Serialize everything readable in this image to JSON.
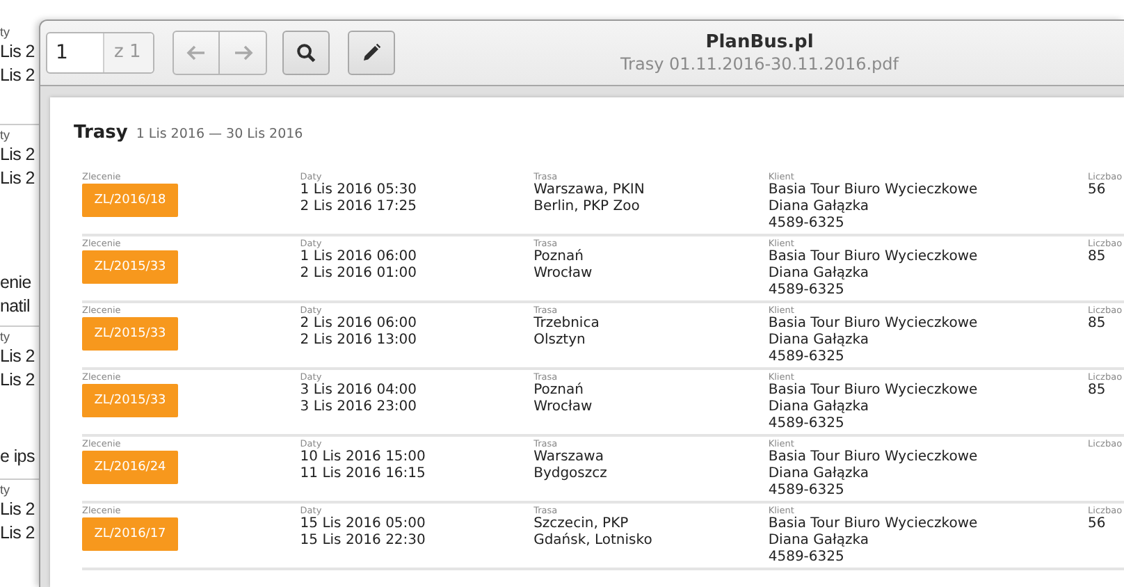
{
  "background_page": {
    "blocks": [
      {
        "lines": [
          {
            "kind": "label",
            "text": "ty"
          },
          {
            "kind": "value",
            "text": "Lis 2"
          },
          {
            "kind": "value",
            "text": "Lis 2"
          }
        ]
      },
      {
        "lines": [
          {
            "kind": "label",
            "text": "ty"
          },
          {
            "kind": "value",
            "text": "Lis 2"
          },
          {
            "kind": "value",
            "text": "Lis 2"
          }
        ]
      },
      {
        "lines": [
          {
            "kind": "value",
            "text": "enie"
          },
          {
            "kind": "value",
            "text": "natil"
          }
        ]
      },
      {
        "lines": [
          {
            "kind": "label",
            "text": "ty"
          },
          {
            "kind": "value",
            "text": "Lis 2"
          },
          {
            "kind": "value",
            "text": "Lis 2"
          }
        ]
      },
      {
        "lines": [
          {
            "kind": "value",
            "text": "e ips"
          }
        ]
      },
      {
        "lines": [
          {
            "kind": "label",
            "text": "ty"
          },
          {
            "kind": "value",
            "text": "Lis 2"
          },
          {
            "kind": "value",
            "text": "Lis 2"
          }
        ]
      }
    ]
  },
  "window": {
    "title": "PlanBus.pl",
    "subtitle": "Trasy 01.11.2016-30.11.2016.pdf"
  },
  "toolbar": {
    "page_number": "1",
    "page_count": "z 1"
  },
  "document": {
    "title": "Trasy",
    "date_range": "1 Lis 2016 — 30 Lis 2016",
    "rows": [
      {
        "labels": [
          "Zlecenie",
          "Daty",
          "Trasa",
          "Klient",
          "Liczbao"
        ],
        "order": "ZL/2016/18",
        "dates": [
          "1 Lis 2016 05:30",
          "2 Lis 2016 17:25"
        ],
        "route": [
          "Warszawa, PKIN",
          "Berlin, PKP Zoo"
        ],
        "client": [
          "Basia Tour Biuro Wycieczkowe",
          "Diana Gałązka",
          "4589-6325"
        ],
        "count": "56"
      },
      {
        "labels": [
          "Zlecenie",
          "Daty",
          "Trasa",
          "Klient",
          "Liczbao"
        ],
        "order": "ZL/2015/33",
        "dates": [
          "1 Lis 2016 06:00",
          "2 Lis 2016 01:00"
        ],
        "route": [
          "Poznań",
          "Wrocław"
        ],
        "client": [
          "Basia Tour Biuro Wycieczkowe",
          "Diana Gałązka",
          "4589-6325"
        ],
        "count": "85"
      },
      {
        "labels": [
          "Zlecenie",
          "Daty",
          "Trasa",
          "Klient",
          "Liczbao"
        ],
        "order": "ZL/2015/33",
        "dates": [
          "2 Lis 2016 06:00",
          "2 Lis 2016 13:00"
        ],
        "route": [
          "Trzebnica",
          "Olsztyn"
        ],
        "client": [
          "Basia Tour Biuro Wycieczkowe",
          "Diana Gałązka",
          "4589-6325"
        ],
        "count": "85"
      },
      {
        "labels": [
          "Zlecenie",
          "Daty",
          "Trasa",
          "Klient",
          "Liczbao"
        ],
        "order": "ZL/2015/33",
        "dates": [
          "3 Lis 2016 04:00",
          "3 Lis 2016 23:00"
        ],
        "route": [
          "Poznań",
          "Wrocław"
        ],
        "client": [
          "Basia Tour Biuro Wycieczkowe",
          "Diana Gałązka",
          "4589-6325"
        ],
        "count": "85"
      },
      {
        "labels": [
          "Zlecenie",
          "Daty",
          "Trasa",
          "Klient",
          "Liczbao"
        ],
        "order": "ZL/2016/24",
        "dates": [
          "10 Lis 2016 15:00",
          "11 Lis 2016 16:15"
        ],
        "route": [
          "Warszawa",
          "Bydgoszcz"
        ],
        "client": [
          "Basia Tour Biuro Wycieczkowe",
          "Diana Gałązka",
          "4589-6325"
        ]
      },
      {
        "labels": [
          "Zlecenie",
          "Daty",
          "Trasa",
          "Klient",
          "Liczbao"
        ],
        "order": "ZL/2016/17",
        "dates": [
          "15 Lis 2016 05:00",
          "15 Lis 2016 22:30"
        ],
        "route": [
          "Szczecin, PKP",
          "Gdańsk, Lotnisko"
        ],
        "client": [
          "Basia Tour Biuro Wycieczkowe",
          "Diana Gałązka",
          "4589-6325"
        ],
        "count": "56"
      }
    ]
  }
}
